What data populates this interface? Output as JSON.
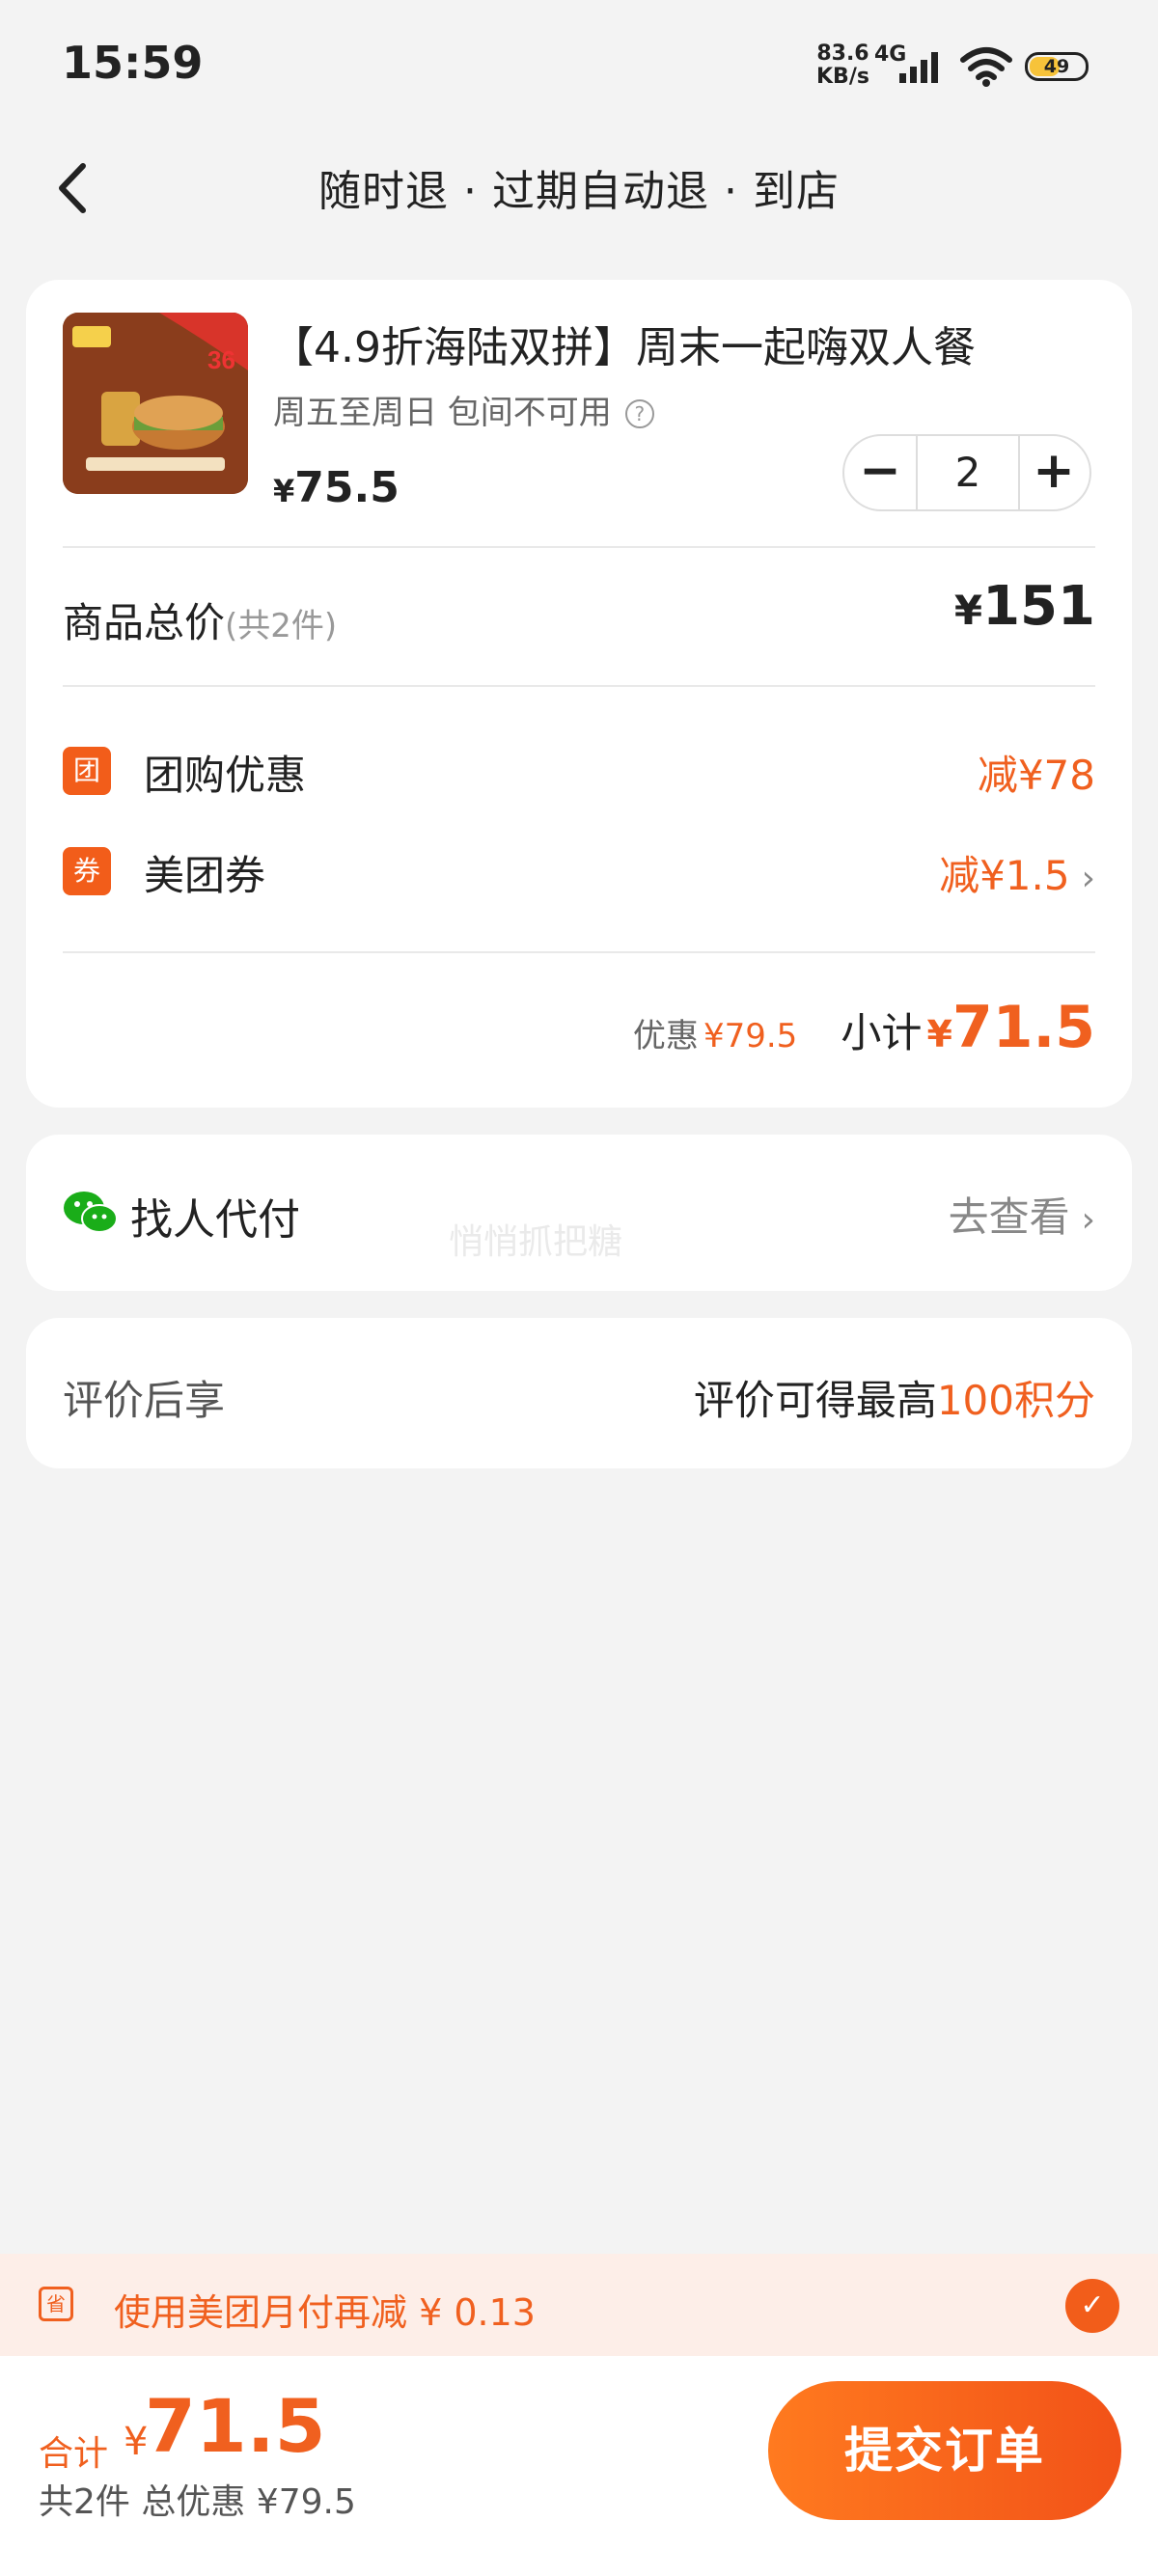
{
  "status_bar": {
    "time": "15:59",
    "net_speed_value": "83.6",
    "net_speed_unit": "KB/s",
    "net_type": "4G",
    "battery": "49"
  },
  "header": {
    "title": "随时退 · 过期自动退 · 到店"
  },
  "product": {
    "title": "【4.9折海陆双拼】周末一起嗨双人餐",
    "subtitle": "周五至周日 包间不可用",
    "currency": "¥",
    "price": "75.5",
    "quantity": "2",
    "image_badge": "36"
  },
  "totals": {
    "label": "商品总价",
    "count": "(共2件)",
    "currency": "¥",
    "value": "151"
  },
  "discounts": [
    {
      "badge": "团",
      "label": "团购优惠",
      "value": "减¥78"
    },
    {
      "badge": "券",
      "label": "美团券",
      "value": "减¥1.5"
    }
  ],
  "subtotal": {
    "saved_label": "优惠",
    "saved_value": "¥79.5",
    "label": "小计",
    "currency": "¥",
    "value": "71.5"
  },
  "pay": {
    "label": "找人代付",
    "link": "去查看",
    "watermark": "悄悄抓把糖"
  },
  "review": {
    "label": "评价后享",
    "text": "评价可得最高",
    "points": "100积分"
  },
  "promo": {
    "icon": "省",
    "text": "使用美团月付再减 ¥ 0.13"
  },
  "footer": {
    "total_label": "合计",
    "currency": "¥",
    "total_value": "71.5",
    "summary": "共2件  总优惠 ¥79.5",
    "submit": "提交订单"
  },
  "colors": {
    "accent": "#f0601f",
    "wechat": "#1aad19"
  }
}
